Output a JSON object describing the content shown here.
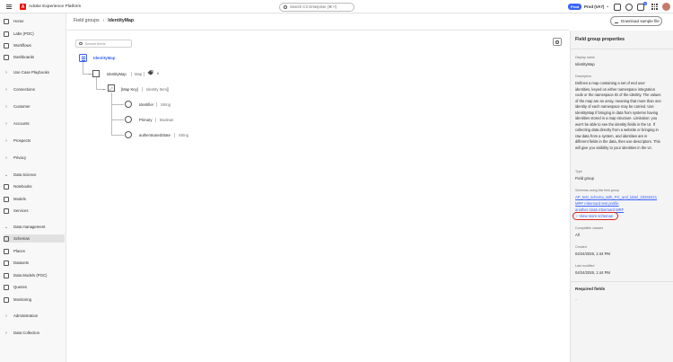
{
  "app": {
    "title": "Adobe Experience Platform",
    "logo_glyph": "A",
    "brand_color": "#eb1000",
    "accent_color": "#3b63fb"
  },
  "topbar": {
    "search_placeholder": "Search CX Enterprise (⌘+/)",
    "env_badge": "Prod",
    "sandbox": "Prod (VA7)",
    "notification_count": "1",
    "icons": [
      "menu-icon",
      "feedback-icon",
      "help-icon",
      "notifications-icon",
      "apps-icon",
      "avatar"
    ]
  },
  "sidebar": {
    "items": [
      {
        "label": "Home",
        "icon": "home-icon",
        "kind": "icon"
      },
      {
        "label": "Labs (POC)",
        "icon": "labs-icon",
        "kind": "icon"
      },
      {
        "label": "Workflows",
        "icon": "workflows-icon",
        "kind": "icon"
      },
      {
        "label": "Dashboards",
        "icon": "dashboards-icon",
        "kind": "icon"
      },
      {
        "label": "Use Case Playbooks",
        "icon": "chevron-right-icon",
        "kind": "chev"
      },
      {
        "label": "Connections",
        "icon": "chevron-right-icon",
        "kind": "chev"
      },
      {
        "label": "Customer",
        "icon": "chevron-right-icon",
        "kind": "chev"
      },
      {
        "label": "Accounts",
        "icon": "chevron-right-icon",
        "kind": "chev"
      },
      {
        "label": "Prospects",
        "icon": "chevron-right-icon",
        "kind": "chev"
      },
      {
        "label": "Privacy",
        "icon": "chevron-right-icon",
        "kind": "chev"
      },
      {
        "label": "Data Science",
        "icon": "chevron-down-icon",
        "kind": "chev"
      },
      {
        "label": "Notebooks",
        "icon": "notebooks-icon",
        "kind": "icon"
      },
      {
        "label": "Models",
        "icon": "models-icon",
        "kind": "icon"
      },
      {
        "label": "Services",
        "icon": "services-icon",
        "kind": "icon"
      },
      {
        "label": "Data management",
        "icon": "chevron-down-icon",
        "kind": "chev"
      },
      {
        "label": "Schemas",
        "icon": "schemas-icon",
        "kind": "icon",
        "active": true
      },
      {
        "label": "Places",
        "icon": "places-icon",
        "kind": "icon"
      },
      {
        "label": "Datasets",
        "icon": "datasets-icon",
        "kind": "icon"
      },
      {
        "label": "Data Models (POC)",
        "icon": "data-models-icon",
        "kind": "icon"
      },
      {
        "label": "Queries",
        "icon": "queries-icon",
        "kind": "icon"
      },
      {
        "label": "Monitoring",
        "icon": "monitoring-icon",
        "kind": "icon"
      },
      {
        "label": "Administration",
        "icon": "chevron-right-icon",
        "kind": "chev"
      },
      {
        "label": "Data Collection",
        "icon": "chevron-right-icon",
        "kind": "chev"
      }
    ]
  },
  "breadcrumb": {
    "parent": "Field groups",
    "separator": "›",
    "current": "IdentityMap"
  },
  "actions": {
    "download_label": "Download sample file"
  },
  "canvas": {
    "search_placeholder": "Search fields",
    "root": {
      "label": "IdentityMap"
    },
    "fields": [
      {
        "name": "IdentityMap",
        "type": "Map",
        "tag_count": "0"
      },
      {
        "name": "[Map Key]",
        "type": "Identity Item[]"
      },
      {
        "name": "Identifier",
        "type": "String"
      },
      {
        "name": "Primary",
        "type": "Boolean"
      },
      {
        "name": "authenticatedState",
        "type": "String"
      }
    ]
  },
  "panel": {
    "title": "Field group properties",
    "display_name_label": "Display name",
    "display_name": "IdentityMap",
    "description_label": "Description",
    "description": "Defines a map containing a set of end user identities, keyed on either namespace integration code or the namespace ID of the identity. The values of the map are an array, meaning that more than one identity of each namespace may be carried. Use IdentityMap if bringing in data from systems having identities stored in a map structure. Limitation: you won't be able to see the identity fields in the UI. If collecting data directly from a website or bringing in raw data from a system, and identities are in different fields in the data, then use descriptors. This will give you visibility to your identities in the UI.",
    "type_label": "Type",
    "type_value": "Field group",
    "schemas_label": "Schemas using this field group",
    "schemas": [
      "AP_test_schema_with_FG_and_label_20260421",
      "MRF mbernard test profile",
      "another class mbernard MRF"
    ],
    "view_more": "View more schemas",
    "compatible_label": "Compatible classes",
    "compatible_value": "All",
    "created_label": "Created",
    "created_value": "04/24/2026, 1:44 PM",
    "modified_label": "Last modified",
    "modified_value": "04/24/2026, 1:44 PM",
    "required_title": "Required fields",
    "required_value": "–"
  }
}
